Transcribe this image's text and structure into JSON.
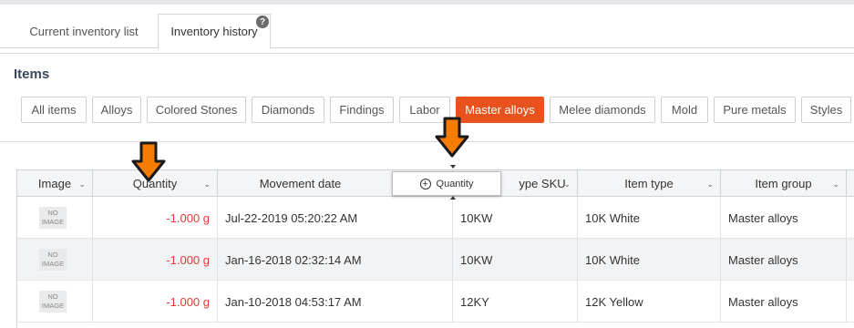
{
  "tabs": [
    {
      "label": "Current inventory list",
      "active": false
    },
    {
      "label": "Inventory history",
      "active": true
    }
  ],
  "help_badge": "?",
  "items": {
    "title": "Items",
    "filters": [
      {
        "label": "All items",
        "active": false
      },
      {
        "label": "Alloys",
        "active": false
      },
      {
        "label": "Colored Stones",
        "active": false
      },
      {
        "label": "Diamonds",
        "active": false
      },
      {
        "label": "Findings",
        "active": false
      },
      {
        "label": "Labor",
        "active": false
      },
      {
        "label": "Master alloys",
        "active": true
      },
      {
        "label": "Melee diamonds",
        "active": false
      },
      {
        "label": "Mold",
        "active": false
      },
      {
        "label": "Pure metals",
        "active": false
      },
      {
        "label": "Styles",
        "active": false
      }
    ]
  },
  "grid": {
    "columns": [
      "Image",
      "Quantity",
      "Movement date",
      "ype SKU",
      "Item type",
      "Item group"
    ],
    "no_image_text": "NO IMAGE",
    "rows": [
      {
        "quantity": "-1.000 g",
        "date": "Jul-22-2019 05:20:22 AM",
        "sku": "10KW",
        "item_type": "10K White",
        "item_group": "Master alloys"
      },
      {
        "quantity": "-1.000 g",
        "date": "Jan-16-2018 02:32:14 AM",
        "sku": "10KW",
        "item_type": "10K White",
        "item_group": "Master alloys"
      },
      {
        "quantity": "-1.000 g",
        "date": "Jan-10-2018 04:53:17 AM",
        "sku": "12KY",
        "item_type": "12K Yellow",
        "item_group": "Master alloys"
      }
    ]
  },
  "drag_ghost": {
    "icon": "plus-circle-icon",
    "label": "Quantity"
  },
  "colors": {
    "accent": "#e8521c",
    "negative": "#e53935",
    "arrow": "#f57c00"
  }
}
